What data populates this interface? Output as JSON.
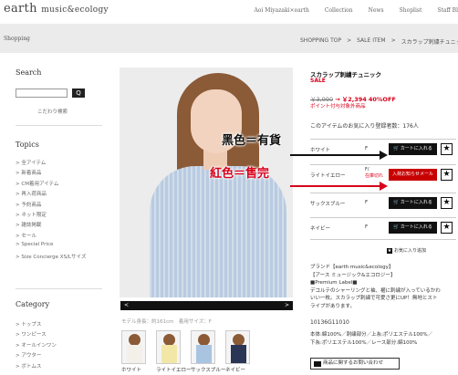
{
  "header": {
    "logo_main": "earth",
    "logo_sub": "music&ecology",
    "nav": [
      "Aoi Miyazaki×earth",
      "Collection",
      "News",
      "Shoplist",
      "Staff Bl"
    ]
  },
  "bar": {
    "category": "Shopping",
    "breadcrumbs": [
      "SHOPPING TOP",
      ">",
      "SALE ITEM",
      ">",
      "スカラップ刺繍チュニック"
    ]
  },
  "sidebar": {
    "search_heading": "Search",
    "search_button": "Q",
    "advanced_search": "こだわり検索",
    "topics_heading": "Topics",
    "topics": [
      "> 全アイテム",
      "> 新着商品",
      "> CM着用アイテム",
      "> 再入荷商品",
      "> 予約商品",
      "> ネット限定",
      "> 雑誌掲載",
      "> セール",
      "> Special Price",
      "> Size Concierge XS/Lサイズ"
    ],
    "category_heading": "Category",
    "categories": [
      "> トップス",
      "> ワンピース",
      "> オールインワン",
      "> アウター",
      "> ボトムス"
    ]
  },
  "gallery": {
    "prev": "<",
    "next": ">",
    "model_info": "モデル身長：約161cm　着用サイズ：F",
    "thumbnails": [
      "ホワイト",
      "ライトイエロー",
      "サックスブルー",
      "ネイビー"
    ],
    "thumb_colors": [
      "#f3f0ea",
      "#f2e7a6",
      "#a9c4e0",
      "#2b3556"
    ]
  },
  "product": {
    "title": "スカラップ刺繍チュニック",
    "sale_label": "SALE",
    "old_price": "￥3,990",
    "arrow": "→",
    "new_price": "￥2,394",
    "discount": "40%OFF",
    "points_note": "ポイント付与対象外商品",
    "favorites": "このアイテムのお気に入り登録者数：176人",
    "variants": [
      {
        "color": "ホワイト",
        "size": "F",
        "button": "カートに入れる",
        "stock": ""
      },
      {
        "color": "ライトイエロー",
        "size": "F/",
        "button": "入荷お知らせメール",
        "stock": "在庫切れ"
      },
      {
        "color": "サックスブルー",
        "size": "F",
        "button": "カートに入れる",
        "stock": ""
      },
      {
        "color": "ネイビー",
        "size": "F",
        "button": "カートに入れる",
        "stock": ""
      }
    ],
    "star": "★",
    "favorite_link": "お気に入り追加",
    "description": [
      "ブランド【earth music&ecology】",
      "【アース ミュージック&エコロジー】",
      "■Premium Label■",
      "デコルテのシャーリングと袖、裾に刺繍が入っているかわ",
      "いい一枚。スカラップ刺繍で可愛さ更にUP！無地とスト",
      "ライプがあります。"
    ],
    "code": "10136G11010",
    "material": [
      "本体:綿100%／刺繍部分／上糸:ポリエステル100%／",
      "下糸:ポリエステル100%／レース部分:綿100%"
    ],
    "inquiry": "商品に関するお問い合わせ"
  },
  "annotations": {
    "black_text": "黑色＝有貨",
    "red_text": "紅色＝售完"
  }
}
